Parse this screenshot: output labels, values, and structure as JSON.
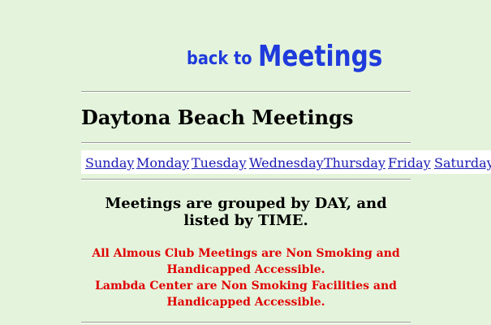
{
  "header": {
    "back_prefix": "back to",
    "back_target": "Meetings"
  },
  "page": {
    "title": "Daytona Beach Meetings"
  },
  "day_nav": [
    {
      "label": "Sunday"
    },
    {
      "label": "Monday"
    },
    {
      "label": "Tuesday"
    },
    {
      "label": "Wednesday"
    },
    {
      "label": "Thursday"
    },
    {
      "label": "Friday"
    },
    {
      "label": "Saturday"
    }
  ],
  "notice": {
    "grouping": "Meetings are grouped by DAY, and listed by TIME."
  },
  "accessibility": {
    "lines": [
      "All Almous Club Meetings are Non Smoking and",
      "Handicapped Accessible.",
      "Lambda Center are Non Smoking Facilities and",
      "Handicapped Accessible."
    ]
  },
  "colors": {
    "background": "#e4f4dc",
    "link": "#1a1ab4",
    "back_link": "#1f3bdc",
    "warning": "#e00000"
  }
}
